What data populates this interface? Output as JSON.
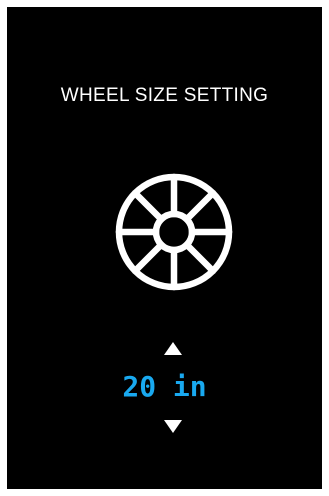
{
  "screen": {
    "title": "WHEEL SIZE SETTING",
    "icon": "wheel-icon",
    "value": "20 in",
    "value_color": "#19a9f0",
    "increase_icon": "triangle-up-icon",
    "decrease_icon": "triangle-down-icon"
  }
}
